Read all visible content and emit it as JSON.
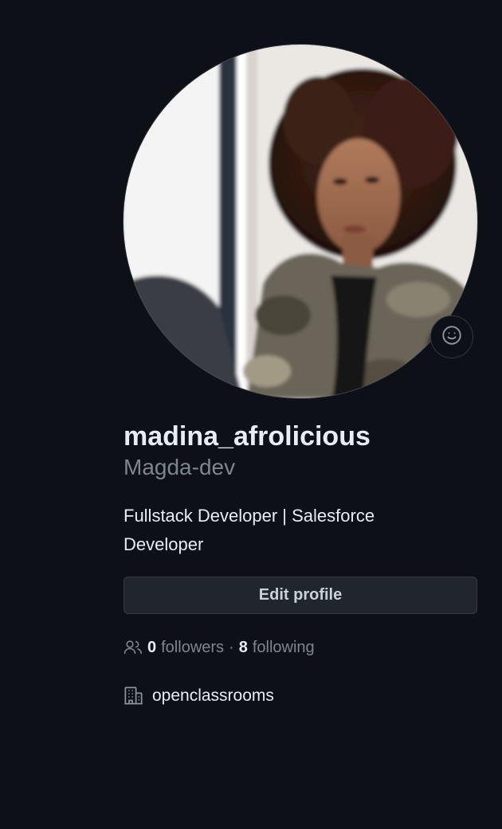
{
  "profile": {
    "avatar_alt": "madina_afrolicious avatar",
    "status_icon": "smiley-icon",
    "username": "madina_afrolicious",
    "display_name": "Magda-dev",
    "bio": "Fullstack Developer | Salesforce Developer",
    "edit_button_label": "Edit profile"
  },
  "social": {
    "people_icon": "people-icon",
    "followers_count": "0",
    "followers_label": "followers",
    "separator": "·",
    "following_count": "8",
    "following_label": "following"
  },
  "details": {
    "org_icon": "organization-icon",
    "company": "openclassrooms"
  },
  "colors": {
    "background": "#0d1117",
    "text_primary": "#e6edf3",
    "text_muted": "#7d8590",
    "button_bg": "#21262d",
    "border": "#30363d"
  }
}
